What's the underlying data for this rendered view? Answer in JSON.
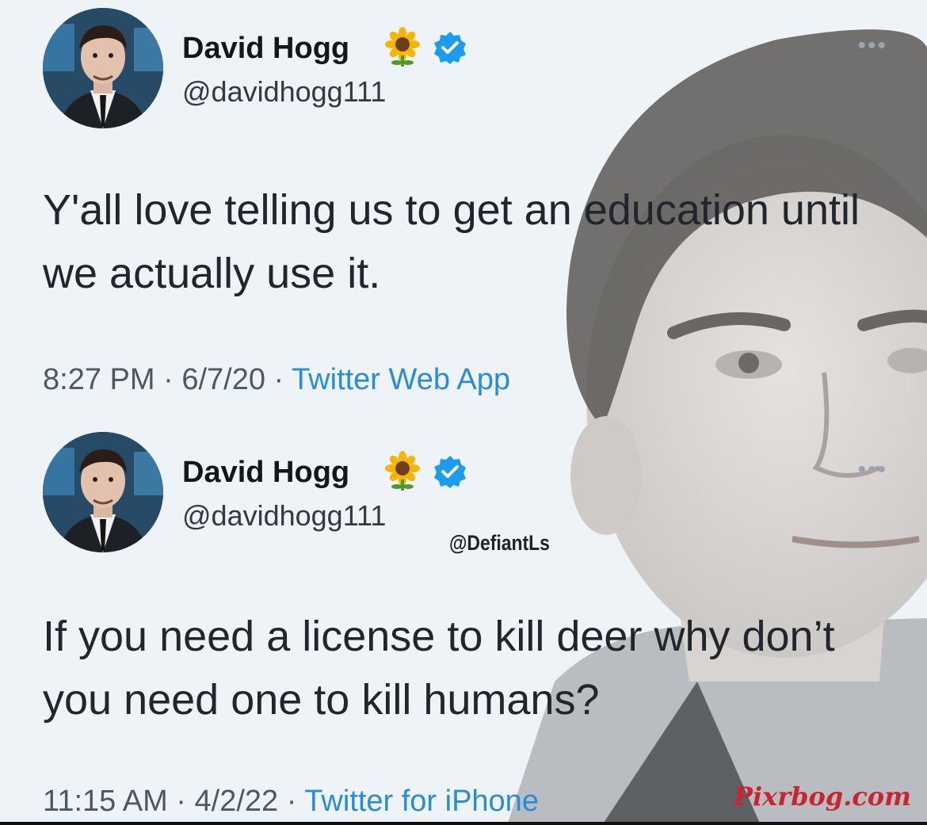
{
  "tweets": [
    {
      "display_name": "David Hogg",
      "handle": "@davidhogg111",
      "text": "Y'all love telling us to get an education until we actually use it.",
      "time": "8:27 PM",
      "date": "6/7/20",
      "source": "Twitter Web App"
    },
    {
      "display_name": "David Hogg",
      "handle": "@davidhogg111",
      "text": "If you need a license to kill deer why don’t you need one to kill humans?",
      "time": "11:15 AM",
      "date": "4/2/22",
      "source": "Twitter for iPhone"
    }
  ],
  "separator": " · ",
  "more_glyph": "•••",
  "watermarks": {
    "defiant": "@DefiantLs",
    "pixrbog": "Pixrbog.com"
  },
  "icons": {
    "name_emoji": "sunflower-icon",
    "verified": "verified-badge-icon",
    "more": "more-options-icon"
  },
  "colors": {
    "verified_blue": "#1d9bf0",
    "source_link": "#2a8bd9",
    "pixrbog_red": "#c8262f"
  }
}
